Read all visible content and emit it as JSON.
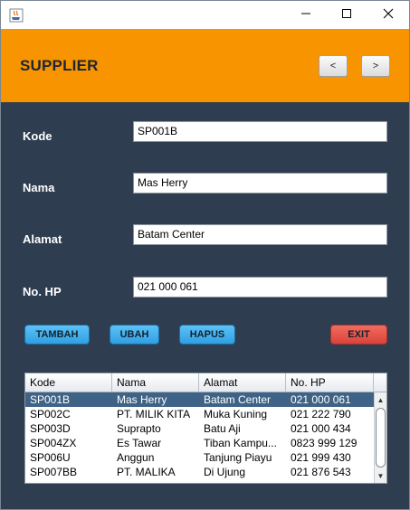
{
  "window": {
    "controls": {
      "minimize_icon": "minimize-icon",
      "maximize_icon": "maximize-icon",
      "close_icon": "close-icon"
    }
  },
  "header": {
    "title": "SUPPLIER",
    "prev_label": "<",
    "next_label": ">",
    "background": "#f79400"
  },
  "form": {
    "kode": {
      "label": "Kode",
      "value": "SP001B"
    },
    "nama": {
      "label": "Nama",
      "value": "Mas Herry"
    },
    "alamat": {
      "label": "Alamat",
      "value": "Batam Center"
    },
    "no_hp": {
      "label": "No. HP",
      "value": "021 000 061"
    }
  },
  "actions": {
    "tambah": "TAMBAH",
    "ubah": "UBAH",
    "hapus": "HAPUS",
    "exit": "EXIT"
  },
  "table": {
    "columns": [
      "Kode",
      "Nama",
      "Alamat",
      "No. HP"
    ],
    "rows": [
      [
        "SP001B",
        "Mas Herry",
        "Batam Center",
        "021 000 061"
      ],
      [
        "SP002C",
        "PT. MILIK KITA",
        "Muka Kuning",
        "021 222 790"
      ],
      [
        "SP003D",
        "Suprapto",
        "Batu Aji",
        "021 000 434"
      ],
      [
        "SP004ZX",
        "Es Tawar",
        "Tiban Kampu...",
        "0823 999 129"
      ],
      [
        "SP006U",
        "Anggun",
        "Tanjung Piayu",
        "021 999 430"
      ],
      [
        "SP007BB",
        "PT. MALIKA",
        "Di Ujung",
        "021 876 543"
      ]
    ],
    "selected_row": 0
  },
  "colors": {
    "panel": "#2e3e50",
    "primary_button": "#3aaaf0",
    "exit_button": "#e8554a",
    "selected_row": "#3f6386"
  }
}
